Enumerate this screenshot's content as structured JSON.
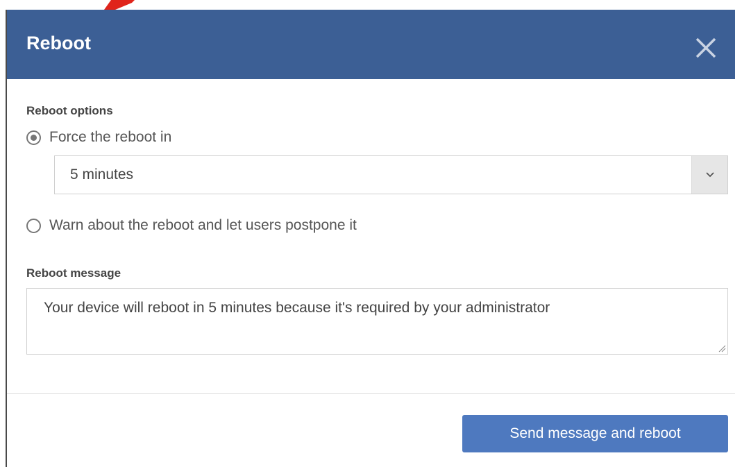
{
  "dialog": {
    "title": "Reboot",
    "close_icon": "close-icon"
  },
  "options": {
    "section_label": "Reboot options",
    "force": {
      "label": "Force the reboot in",
      "checked": true
    },
    "delay_select": {
      "value": "5 minutes",
      "icon": "chevron-down-icon"
    },
    "warn": {
      "label": "Warn about the reboot and let users postpone it",
      "checked": false
    }
  },
  "message": {
    "section_label": "Reboot message",
    "value": "Your device will reboot in 5 minutes because it's required by your administrator"
  },
  "footer": {
    "submit_label": "Send message and reboot"
  },
  "colors": {
    "header": "#3c5f95",
    "primary_button": "#4e79bf",
    "arrow": "#e0241b"
  }
}
